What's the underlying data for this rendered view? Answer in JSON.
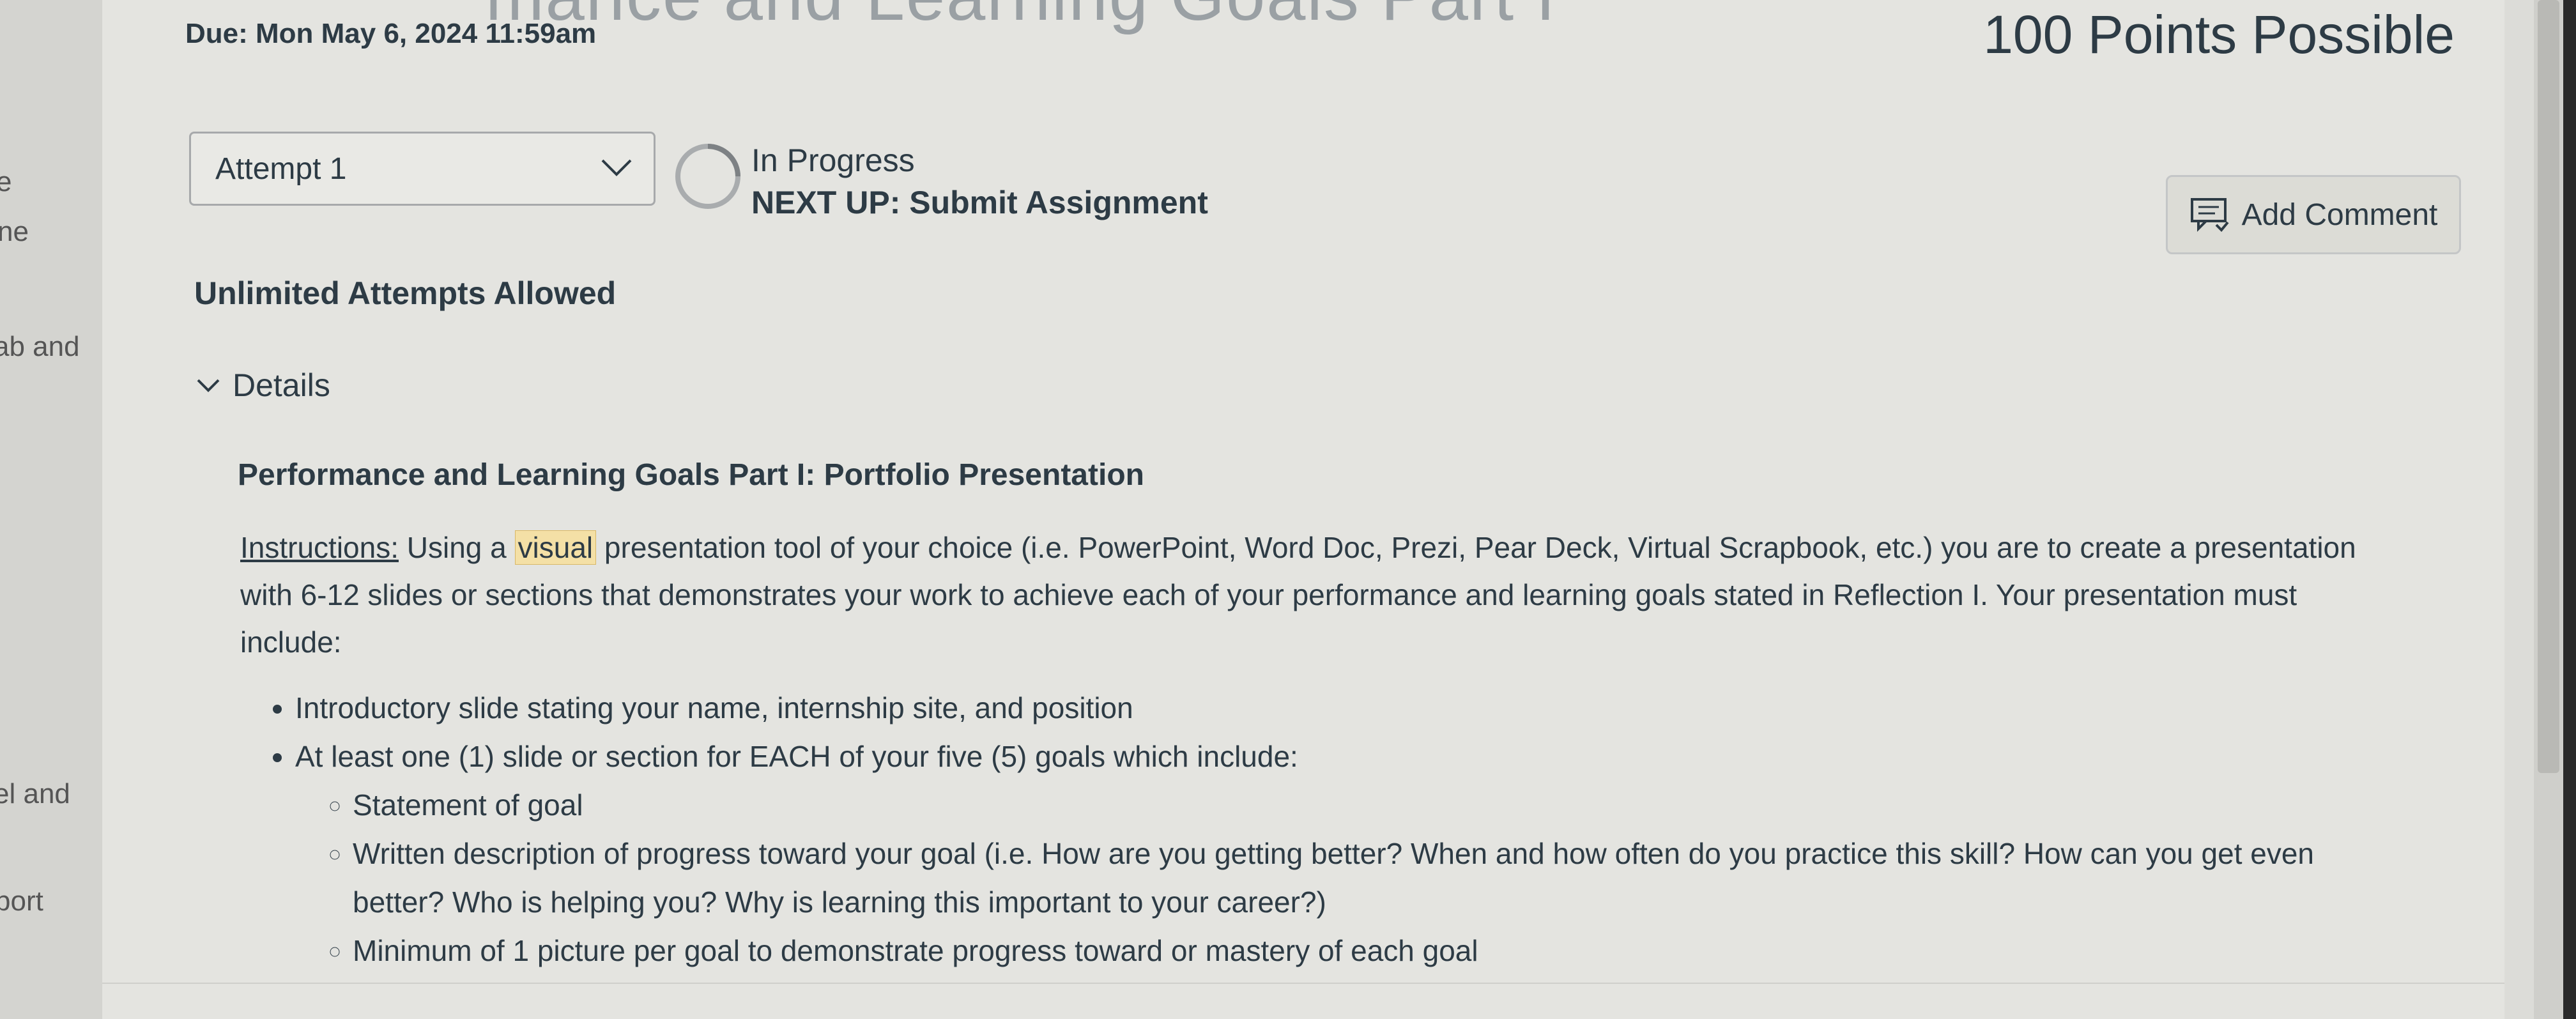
{
  "left_nav": {
    "items": [
      "e",
      "ne",
      "ab and",
      "el and",
      "port"
    ]
  },
  "header": {
    "title_partial": "mance and Learning Goals Part I",
    "due": "Due: Mon May 6, 2024 11:59am",
    "points": "100 Points Possible"
  },
  "attempt": {
    "select_label": "Attempt 1",
    "status": "In Progress",
    "next_up": "NEXT UP: Submit Assignment"
  },
  "comment": {
    "button_label": "Add Comment"
  },
  "attempts_allowed": "Unlimited Attempts Allowed",
  "details": {
    "toggle_label": "Details",
    "section_title": "Performance and Learning Goals Part I: Portfolio Presentation",
    "instructions_label": "Instructions:",
    "instructions_pre": " Using a ",
    "instructions_highlight": "visual",
    "instructions_post": " presentation tool of your choice (i.e. PowerPoint, Word Doc, Prezi, Pear Deck, Virtual Scrapbook, etc.) you are to create a presentation with 6-12 slides or sections that demonstrates your work to achieve each of your performance and learning goals stated in Reflection I. Your presentation must include:",
    "bullets": [
      "Introductory slide stating your name, internship site, and position",
      "At least one (1) slide or section for EACH of your five (5) goals which include:"
    ],
    "sub_bullets": [
      "Statement of goal",
      "Written description of progress toward your goal (i.e. How are you getting better? When and how often do you practice this skill? How can you get even better? Who is helping you? Why is learning this important to your career?)",
      "Minimum of 1 picture per goal to demonstrate progress toward or mastery of each goal"
    ]
  },
  "colors": {
    "text": "#2d3b45",
    "highlight": "#f4e0a6",
    "background": "#e4e4e0"
  },
  "icons": [
    "chevron-down-icon",
    "progress-ring-icon",
    "comment-icon",
    "chevron-down-icon"
  ]
}
